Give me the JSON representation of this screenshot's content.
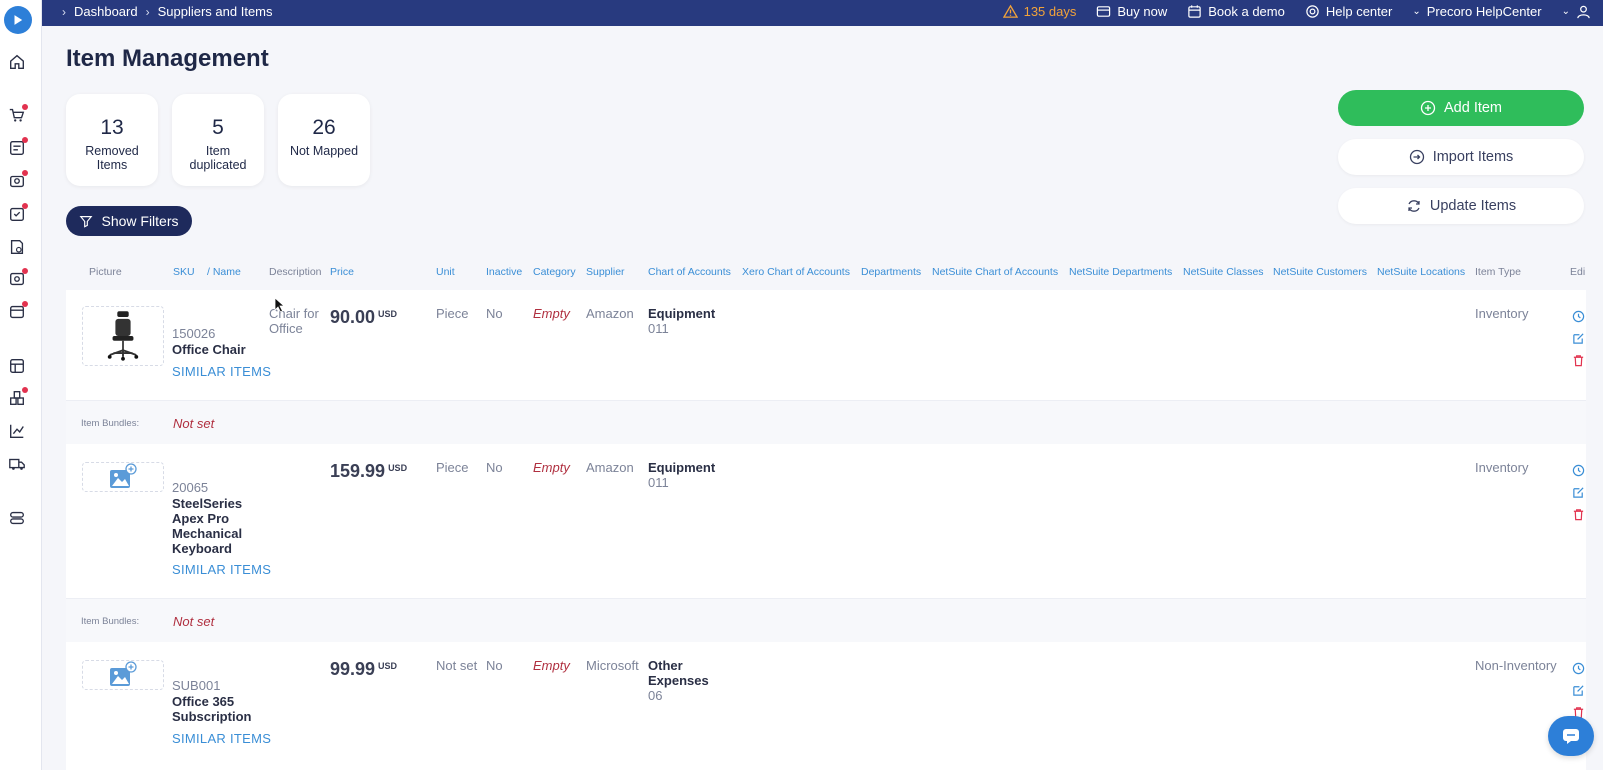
{
  "breadcrumb": {
    "items": [
      "Dashboard",
      "Suppliers and Items"
    ]
  },
  "topbar": {
    "trial": "135 days",
    "buy_now": "Buy now",
    "book_demo": "Book a demo",
    "help_center": "Help center",
    "account": "Precoro HelpCenter"
  },
  "page": {
    "title": "Item Management"
  },
  "stats": [
    {
      "value": "13",
      "label": "Removed Items"
    },
    {
      "value": "5",
      "label": "Item duplicated"
    },
    {
      "value": "26",
      "label": "Not Mapped"
    }
  ],
  "filters": {
    "label": "Show Filters"
  },
  "actions": {
    "add": "Add Item",
    "import": "Import Items",
    "update": "Update Items"
  },
  "table": {
    "columns": {
      "picture": "Picture",
      "sku": "SKU",
      "name": "/ Name",
      "description": "Description",
      "price": "Price",
      "unit": "Unit",
      "inactive": "Inactive",
      "category": "Category",
      "supplier": "Supplier",
      "coa": "Chart of Accounts",
      "xero_coa": "Xero Chart of Accounts",
      "departments": "Departments",
      "ns_coa": "NetSuite Chart of Accounts",
      "ns_departments": "NetSuite Departments",
      "ns_classes": "NetSuite Classes",
      "ns_customers": "NetSuite Customers",
      "ns_locations": "NetSuite Locations",
      "item_type": "Item Type",
      "edit": "Edi"
    },
    "similar_label": "SIMILAR ITEMS",
    "bundle_label": "Item Bundles:",
    "rows": [
      {
        "sku": "150026",
        "name": "Office Chair",
        "description": "Chair for Office",
        "price": "90.00",
        "currency": "USD",
        "unit": "Piece",
        "inactive": "No",
        "category": "Empty",
        "supplier": "Amazon",
        "coa_name": "Equipment",
        "coa_code": "011",
        "item_type": "Inventory",
        "bundle": "Not set"
      },
      {
        "sku": "20065",
        "name": "SteelSeries Apex Pro Mechanical Keyboard",
        "description": "",
        "price": "159.99",
        "currency": "USD",
        "unit": "Piece",
        "inactive": "No",
        "category": "Empty",
        "supplier": "Amazon",
        "coa_name": "Equipment",
        "coa_code": "011",
        "item_type": "Inventory",
        "bundle": "Not set"
      },
      {
        "sku": "SUB001",
        "name": "Office 365 Subscription",
        "description": "",
        "price": "99.99",
        "currency": "USD",
        "unit": "Not set",
        "inactive": "No",
        "category": "Empty",
        "supplier": "Microsoft",
        "coa_name": "Other Expenses",
        "coa_code": "06",
        "item_type": "Non-Inventory"
      }
    ]
  },
  "colors": {
    "topbar": "#283a7f",
    "accent": "#3a8ed6",
    "primary_button": "#2fbd5b",
    "danger": "#e2324f",
    "filters_button": "#1e2a5c"
  }
}
